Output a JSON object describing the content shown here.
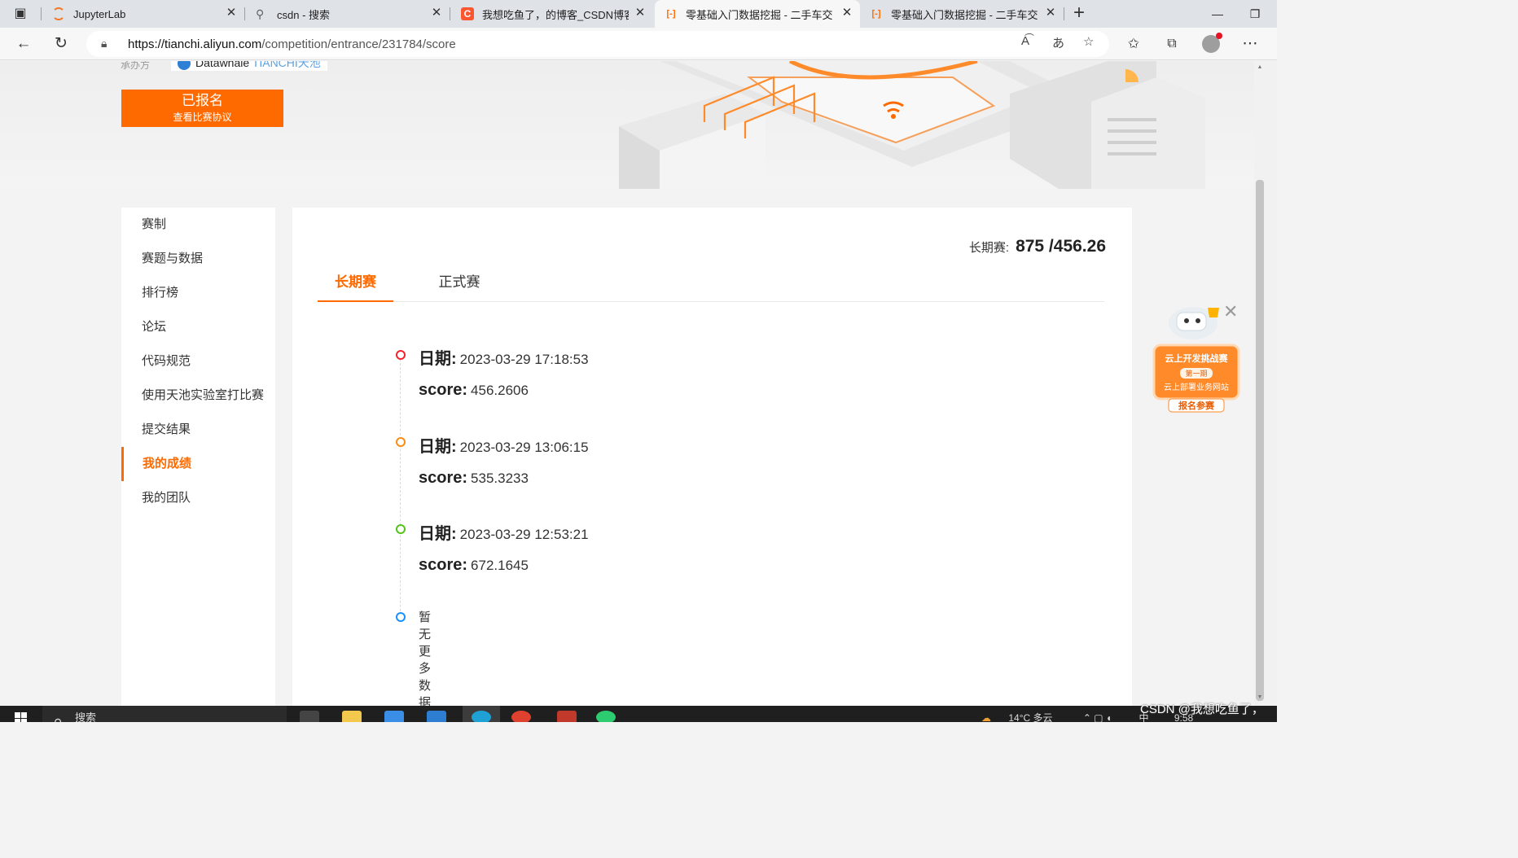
{
  "browser": {
    "tabs": [
      {
        "label": "JupyterLab",
        "icon": "jupyter-icon",
        "active": false
      },
      {
        "label": "csdn - 搜索",
        "icon": "search-icon",
        "active": false
      },
      {
        "label": "我想吃鱼了，的博客_CSDN博客-",
        "icon": "csdn-icon",
        "active": false
      },
      {
        "label": "零基础入门数据挖掘 - 二手车交易",
        "icon": "tianchi-icon",
        "active": true
      },
      {
        "label": "零基础入门数据挖掘 - 二手车交易",
        "icon": "tianchi-icon",
        "active": false
      }
    ],
    "url_host": "https://tianchi.aliyun.com",
    "url_path": "/competition/entrance/231784/score"
  },
  "header": {
    "partner_label": "承办方",
    "partner_logo_a": "Datawhale",
    "partner_logo_b": "TIANCHI天池",
    "registered_title": "已报名",
    "registered_sub": "查看比赛协议"
  },
  "sidebar": {
    "items": [
      {
        "label": "赛制",
        "active": false
      },
      {
        "label": "赛题与数据",
        "active": false
      },
      {
        "label": "排行榜",
        "active": false
      },
      {
        "label": "论坛",
        "active": false
      },
      {
        "label": "代码规范",
        "active": false
      },
      {
        "label": "使用天池实验室打比赛",
        "active": false
      },
      {
        "label": "提交结果",
        "active": false
      },
      {
        "label": "我的成绩",
        "active": true
      },
      {
        "label": "我的团队",
        "active": false
      }
    ]
  },
  "main": {
    "summary_label": "长期赛:",
    "summary_value": "875 /456.26",
    "tabs": [
      {
        "label": "长期赛",
        "active": true
      },
      {
        "label": "正式赛",
        "active": false
      }
    ],
    "date_key": "日期:",
    "score_key": "score:",
    "records": [
      {
        "date": "2023-03-29 17:18:53",
        "score": "456.2606",
        "dot_color": "#f5222d"
      },
      {
        "date": "2023-03-29 13:06:15",
        "score": "535.3233",
        "dot_color": "#fa8c16"
      },
      {
        "date": "2023-03-29 12:53:21",
        "score": "672.1645",
        "dot_color": "#52c41a"
      }
    ],
    "empty_text": "暂无更多数据",
    "empty_dot_color": "#1890ff"
  },
  "float_ad": {
    "line1": "云上开发挑战赛",
    "line2": "第一期",
    "line3": "云上部署业务网站",
    "line4": "报名参赛"
  },
  "taskbar": {
    "search_placeholder": "搜索",
    "weather": "14°C 多云",
    "ime": "中",
    "time": "9:58"
  },
  "watermark": "CSDN @我想吃鱼了，",
  "colors": {
    "accent": "#ff6a00"
  }
}
